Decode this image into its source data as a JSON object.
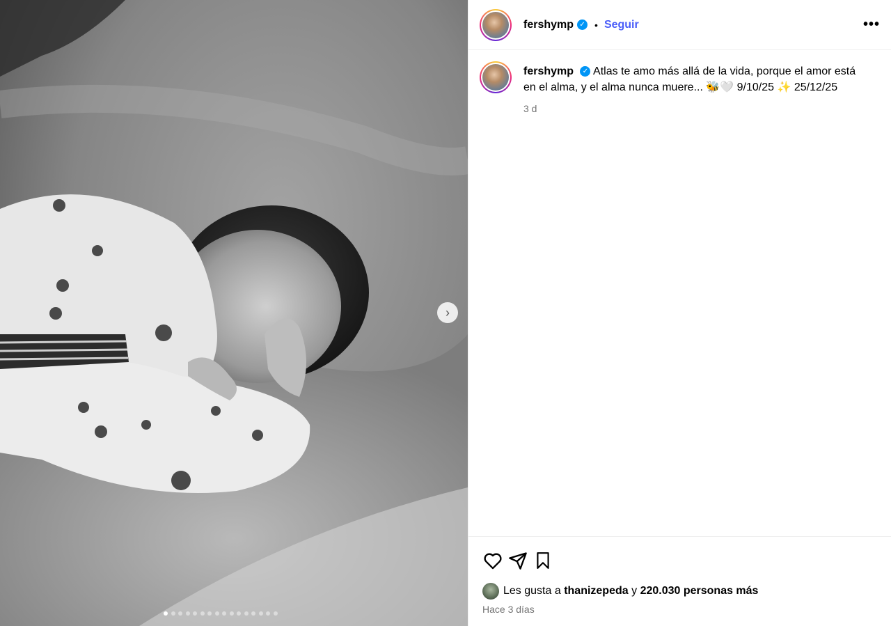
{
  "post": {
    "username": "fershymp",
    "follow_label": "Seguir",
    "more_label": "•••",
    "caption_text": "Atlas te amo más allá de la vida, porque el amor está en el alma, y el alma nunca muere... 🐝🤍 9/10/25 ✨ 25/12/25",
    "caption_time": "3 d",
    "likes_prefix": "Les gusta a",
    "likes_user": "thanizepeda",
    "likes_conj": "y",
    "likes_rest": "220.030 personas más",
    "posted_ago": "Hace 3 días"
  },
  "media": {
    "next_label": "›",
    "slide_count": 16,
    "active_slide": 1
  },
  "icons": {
    "verified": "verified-badge-icon",
    "like": "heart-icon",
    "share": "send-icon",
    "save": "bookmark-icon",
    "next": "chevron-right-icon"
  }
}
